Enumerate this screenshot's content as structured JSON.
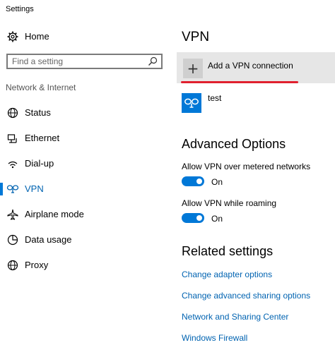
{
  "window": {
    "title": "Settings"
  },
  "sidebar": {
    "home_label": "Home",
    "search_placeholder": "Find a setting",
    "section_label": "Network & Internet",
    "items": [
      {
        "label": "Status",
        "icon": "globe-icon"
      },
      {
        "label": "Ethernet",
        "icon": "ethernet-icon"
      },
      {
        "label": "Dial-up",
        "icon": "dialup-icon"
      },
      {
        "label": "VPN",
        "icon": "vpn-icon",
        "active": true
      },
      {
        "label": "Airplane mode",
        "icon": "airplane-icon"
      },
      {
        "label": "Data usage",
        "icon": "data-usage-icon"
      },
      {
        "label": "Proxy",
        "icon": "globe-icon"
      }
    ]
  },
  "main": {
    "title": "VPN",
    "add_vpn_label": "Add a VPN connection",
    "add_vpn_icon": "plus-icon",
    "vpn_connections": [
      {
        "name": "test",
        "icon": "vpn-icon"
      }
    ],
    "advanced_title": "Advanced Options",
    "options": [
      {
        "label": "Allow VPN over metered networks",
        "state": "On"
      },
      {
        "label": "Allow VPN while roaming",
        "state": "On"
      }
    ],
    "related_title": "Related settings",
    "related_links": [
      "Change adapter options",
      "Change advanced sharing options",
      "Network and Sharing Center",
      "Windows Firewall"
    ]
  },
  "colors": {
    "accent": "#0078d7",
    "link": "#0063b1",
    "annotation_red": "#e0202e"
  }
}
